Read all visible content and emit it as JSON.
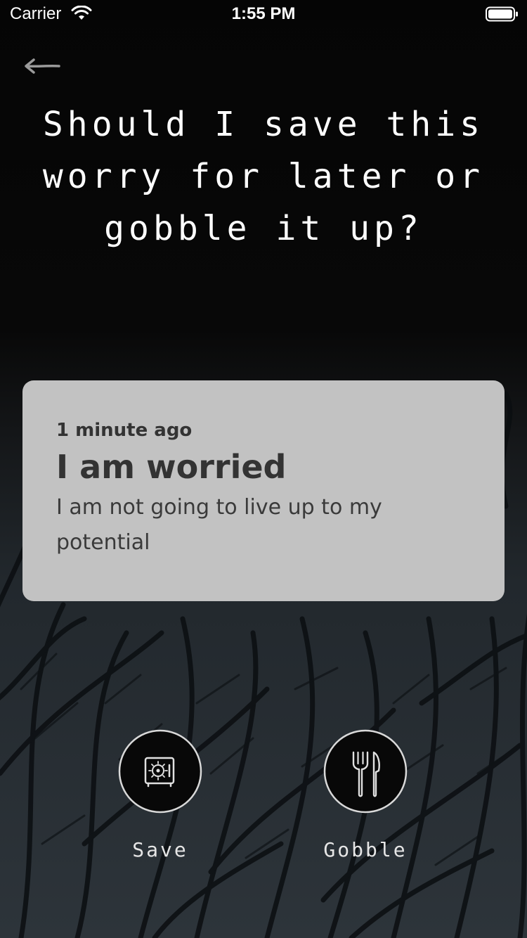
{
  "status_bar": {
    "carrier": "Carrier",
    "time": "1:55 PM",
    "wifi_icon": "wifi-icon",
    "battery_icon": "battery-icon"
  },
  "nav": {
    "back_icon": "back-arrow-icon"
  },
  "header": {
    "question": "Should I save this worry for later or gobble it up?"
  },
  "worry": {
    "timestamp": "1 minute ago",
    "title": "I am worried",
    "body": "I am not going to live up to my potential"
  },
  "actions": {
    "save_label": "Save",
    "save_icon": "safe-icon",
    "gobble_label": "Gobble",
    "gobble_icon": "fork-knife-icon"
  },
  "colors": {
    "background_top": "#050505",
    "background_leaves": "#2b3238",
    "card_background": "#c2c2c2",
    "card_text": "#333333",
    "accent_text": "#ffffff"
  }
}
